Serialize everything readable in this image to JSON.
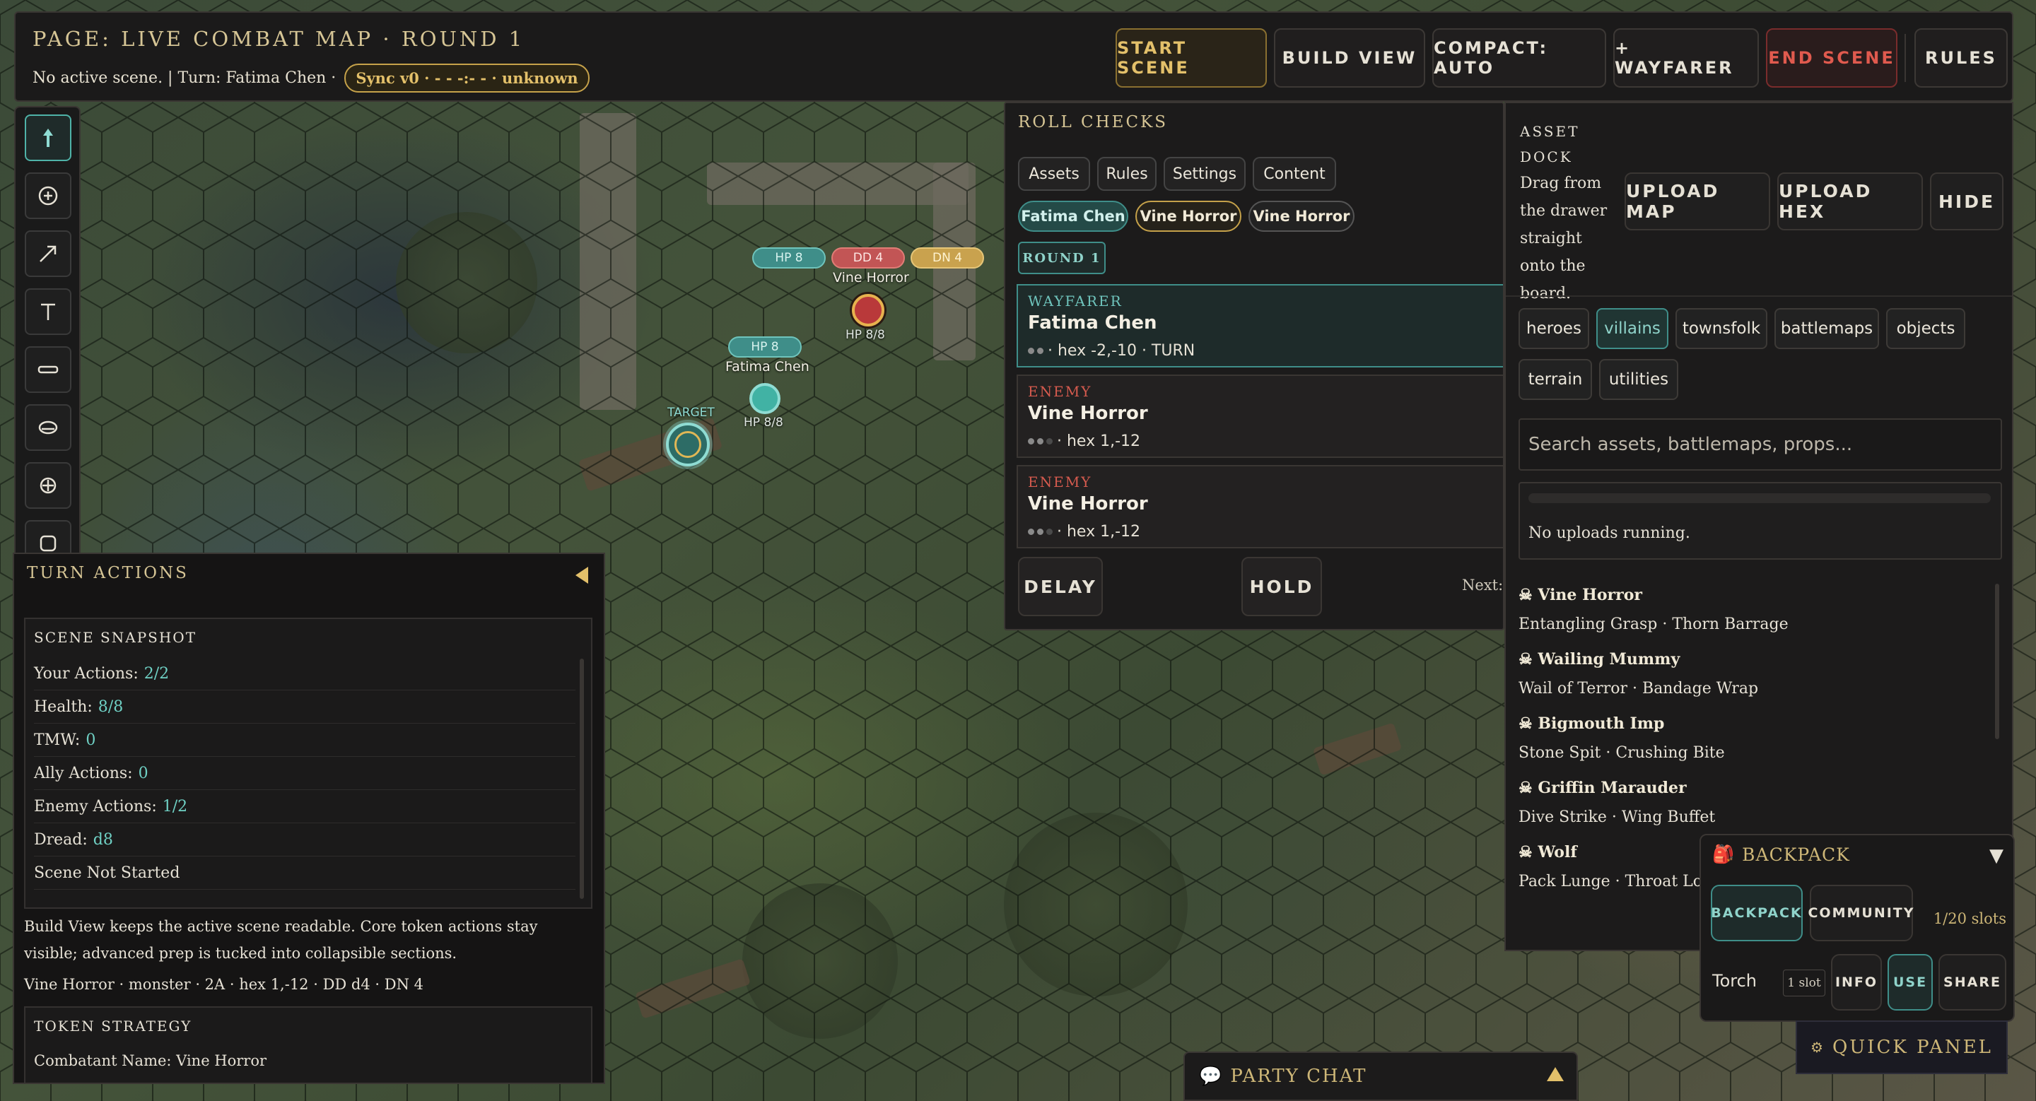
{
  "header": {
    "title": "PAGE: LIVE COMBAT MAP · ROUND 1",
    "status": "No active scene. | Turn: Fatima Chen ·",
    "sync": "Sync v0 · - - -:- - · unknown",
    "buttons": {
      "start": "START SCENE",
      "build": "BUILD VIEW",
      "compact": "COMPACT: AUTO",
      "wayfarer": "+ WAYFARER",
      "end": "END SCENE",
      "rules": "RULES"
    }
  },
  "toolbar": {
    "tools": [
      "move-arrow-icon",
      "add-circle-icon",
      "line-arrow-icon",
      "text-tool-icon",
      "ruler-icon",
      "cone-icon",
      "crosshair-icon",
      "square-icon"
    ]
  },
  "map": {
    "enemy_token": {
      "hp": "HP 8",
      "dd": "DD 4",
      "dn": "DN 4",
      "name": "Vine Horror",
      "sub": "HP 8/8"
    },
    "ally_token": {
      "hp": "HP 8",
      "name": "Fatima Chen",
      "sub": "HP 8/8"
    },
    "target_label": "TARGET"
  },
  "roll_panel": {
    "title": "ROLL CHECKS",
    "tabs": [
      "Assets",
      "Rules",
      "Settings",
      "Content"
    ],
    "chips": [
      "Fatima Chen",
      "Vine Horror",
      "Vine Horror"
    ],
    "round": "ROUND 1",
    "turns": [
      {
        "role": "WAYFARER",
        "name": "Fatima Chen",
        "meta": "· hex -2,-10 · TURN"
      },
      {
        "role": "ENEMY",
        "name": "Vine Horror",
        "meta": "· hex 1,-12"
      },
      {
        "role": "ENEMY",
        "name": "Vine Horror",
        "meta": "· hex 1,-12"
      }
    ],
    "delay": "DELAY",
    "hold": "HOLD",
    "next": "Next: Vine Horror"
  },
  "asset_dock": {
    "title": "ASSET DOCK",
    "help": "Drag from the drawer straight onto the board.",
    "upload_map": "UPLOAD MAP",
    "upload_hex": "UPLOAD HEX",
    "hide": "HIDE",
    "categories": [
      "heroes",
      "villains",
      "townsfolk",
      "battlemaps",
      "objects",
      "terrain",
      "utilities"
    ],
    "active_category": "villains",
    "search_placeholder": "Search assets, battlemaps, props...",
    "upload_status": "No uploads running.",
    "enemies": [
      {
        "name": "Vine Horror",
        "moves": "Entangling Grasp · Thorn Barrage"
      },
      {
        "name": "Wailing Mummy",
        "moves": "Wail of Terror · Bandage Wrap"
      },
      {
        "name": "Bigmouth Imp",
        "moves": "Stone Spit · Crushing Bite"
      },
      {
        "name": "Griffin Marauder",
        "moves": "Dive Strike · Wing Buffet"
      },
      {
        "name": "Wolf",
        "moves": "Pack Lunge · Throat Lock"
      }
    ]
  },
  "backpack": {
    "title": "BACKPACK",
    "tab_backpack": "BACKPACK",
    "tab_community": "COMMUNITY",
    "slots": "1/20 slots",
    "item": "Torch",
    "item_slot": "1 slot",
    "info": "INFO",
    "use": "USE",
    "share": "SHARE"
  },
  "quick_panel": "QUICK PANEL",
  "party_chat": "PARTY CHAT",
  "info_panel": {
    "title": "TURN ACTIONS",
    "snapshot_title": "SCENE SNAPSHOT",
    "snapshot": [
      {
        "label": "Your Actions:",
        "value": "2/2"
      },
      {
        "label": "Health:",
        "value": "8/8"
      },
      {
        "label": "TMW:",
        "value": "0"
      },
      {
        "label": "Ally Actions:",
        "value": "0"
      },
      {
        "label": "Enemy Actions:",
        "value": "1/2"
      },
      {
        "label": "Dread:",
        "value": "d8"
      },
      {
        "label": "Scene Not Started",
        "value": ""
      }
    ],
    "note": "Build View keeps the active scene readable. Core token actions stay visible; advanced prep is tucked into collapsible sections.",
    "summary": "Vine Horror · monster · 2A · hex 1,-12 · DD d4 · DN 4",
    "strategy_title": "TOKEN STRATEGY",
    "strategy_line": "Combatant Name: Vine Horror"
  },
  "colors": {
    "accent_teal": "#3f8e89",
    "accent_gold": "#c6a24a",
    "danger": "#e05a4e"
  }
}
